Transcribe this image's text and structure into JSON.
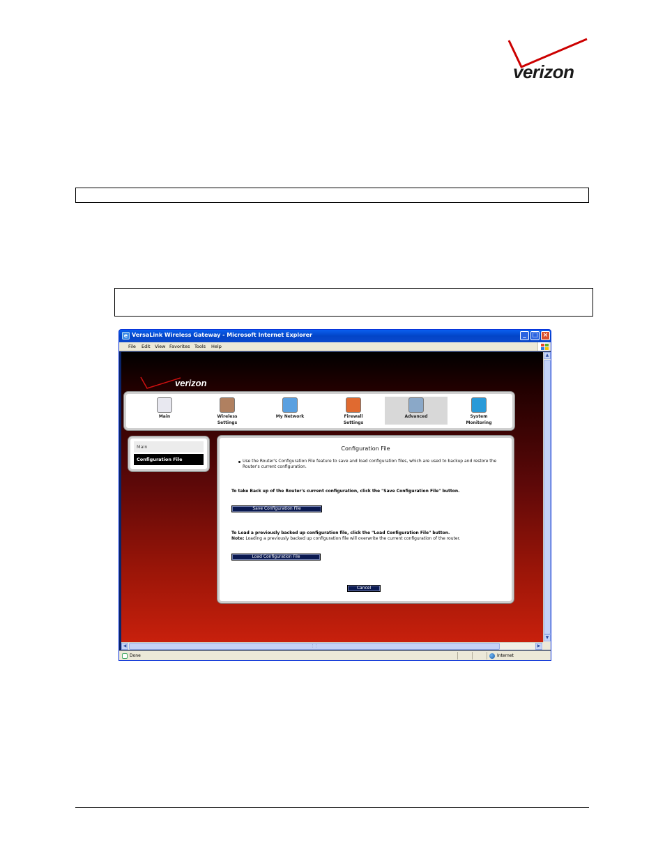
{
  "document": {
    "logo_text": "verizon"
  },
  "browser": {
    "title": "VersaLink Wireless Gateway - Microsoft Internet Explorer",
    "menu": [
      "File",
      "Edit",
      "View",
      "Favorites",
      "Tools",
      "Help"
    ],
    "status_text": "Done",
    "zone_text": "Internet"
  },
  "app": {
    "logo_text": "verizon",
    "nav": [
      {
        "label_line1": "Main",
        "label_line2": "",
        "icon_color": "#e8e8f0"
      },
      {
        "label_line1": "Wireless",
        "label_line2": "Settings",
        "icon_color": "#b08060"
      },
      {
        "label_line1": "My Network",
        "label_line2": "",
        "icon_color": "#5aa0e0"
      },
      {
        "label_line1": "Firewall",
        "label_line2": "Settings",
        "icon_color": "#e06a30"
      },
      {
        "label_line1": "Advanced",
        "label_line2": "",
        "icon_color": "#8aa8c8"
      },
      {
        "label_line1": "System",
        "label_line2": "Monitoring",
        "icon_color": "#2a9ad8"
      }
    ],
    "active_nav": "Advanced",
    "sidebar": {
      "items": [
        "Main",
        "Configuration File"
      ],
      "selected": "Configuration File"
    },
    "content": {
      "title": "Configuration File",
      "bullet": "Use the Router's Configuration File feature to save and load configuration files, which are used to backup and restore the Router's current configuration.",
      "backup_instruction": "To take Back up of the Router's current configuration, click the \"Save Configuration File\" button.",
      "save_button": "Save Configuration File",
      "load_instruction": "To Load a previously backed up configuration file, click the \"Load Configuration File\" button.",
      "note_label": "Note:",
      "note_text": " Loading a previously backed up configuration file will overwrite the current configuration of the router.",
      "load_button": "Load Configuration File",
      "cancel_button": "Cancel"
    }
  }
}
